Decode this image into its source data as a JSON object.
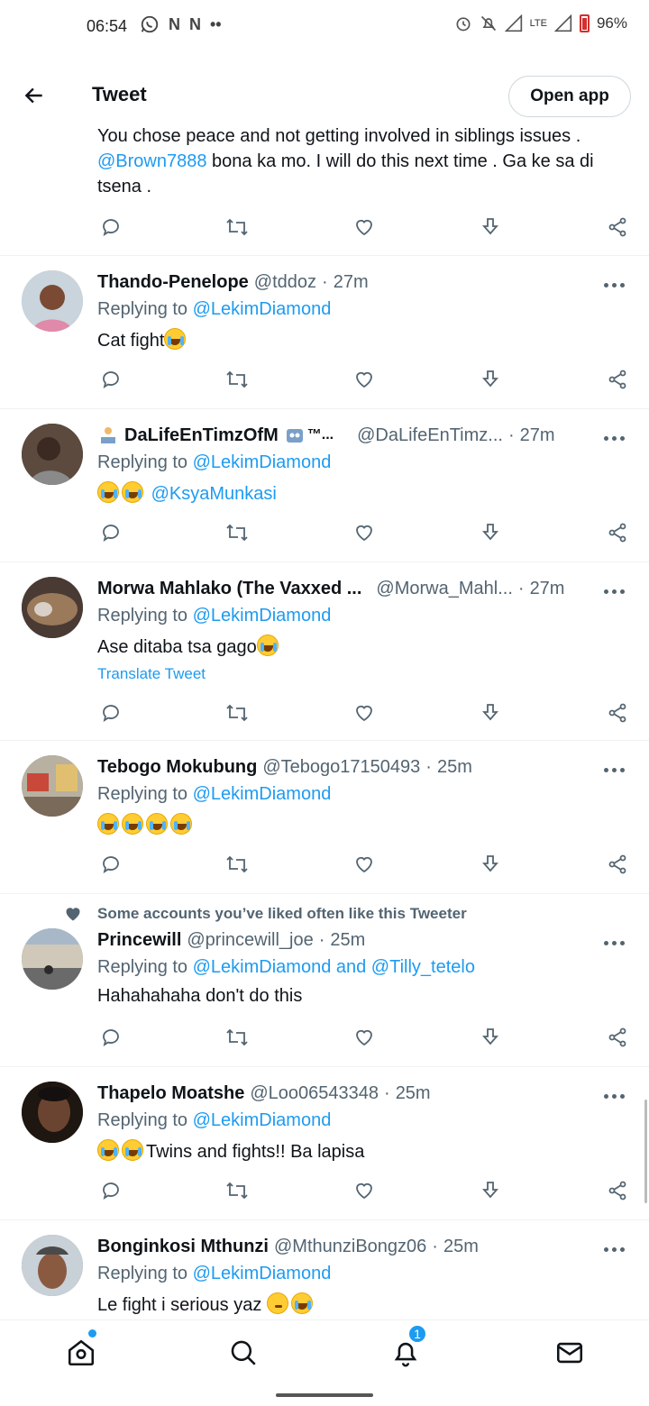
{
  "status_bar": {
    "time": "06:54",
    "network": "LTE",
    "battery": "96%"
  },
  "header": {
    "title": "Tweet",
    "open_app": "Open app"
  },
  "partial_tweet": {
    "line1": "You chose peace and not getting involved in siblings issues .",
    "mention": "@Brown7888",
    "line2": " bona ka mo. I will do this next time . Ga ke sa di",
    "line3": "tsena ."
  },
  "tweets": [
    {
      "name": "Thando-Penelope",
      "handle": "@tddoz",
      "time": "27m",
      "replying_label": "Replying to",
      "replying_to": "@LekimDiamond",
      "body": "Cat fight",
      "avatar_color": "#d9b8a8"
    },
    {
      "name": "DaLifeEnTimzOfM",
      "name_suffix": "™...",
      "handle": "@DaLifeEnTimz...",
      "time": "27m",
      "replying_label": "Replying to",
      "replying_to": "@LekimDiamond",
      "body_mention": "@KsyaMunkasi",
      "avatar_color": "#5a4a42"
    },
    {
      "name": "Morwa Mahlako (The Vaxxed ...",
      "handle": "@Morwa_Mahl...",
      "time": "27m",
      "replying_label": "Replying to",
      "replying_to": "@LekimDiamond",
      "body": "Ase ditaba tsa gago",
      "translate": "Translate Tweet",
      "avatar_color": "#6b5a4a"
    },
    {
      "name": "Tebogo Mokubung",
      "handle": "@Tebogo17150493",
      "time": "25m",
      "replying_label": "Replying to",
      "replying_to": "@LekimDiamond",
      "avatar_color": "#8a8a80"
    },
    {
      "social_context": "Some accounts you’ve liked often like this Tweeter",
      "name": "Princewill",
      "handle": "@princewill_joe",
      "time": "25m",
      "replying_label": "Replying to",
      "replying_to": "@LekimDiamond and @Tilly_tetelo",
      "body": "Hahahahaha don't do this",
      "avatar_color": "#8fa2b8"
    },
    {
      "name": "Thapelo Moatshe",
      "handle": "@Loo06543348",
      "time": "25m",
      "replying_label": "Replying to",
      "replying_to": "@LekimDiamond",
      "body": "Twins and fights!! Ba lapisa",
      "avatar_color": "#3a2a20"
    },
    {
      "name": "Bonginkosi Mthunzi",
      "handle": "@MthunziBongz06",
      "time": "25m",
      "replying_label": "Replying to",
      "replying_to": "@LekimDiamond",
      "body": "Le fight i serious yaz ",
      "avatar_color": "#9a8070"
    }
  ],
  "bottom_nav": {
    "notifications_count": "1"
  },
  "colors": {
    "accent": "#1d9bf0",
    "muted": "#536471",
    "text": "#0f1419"
  }
}
